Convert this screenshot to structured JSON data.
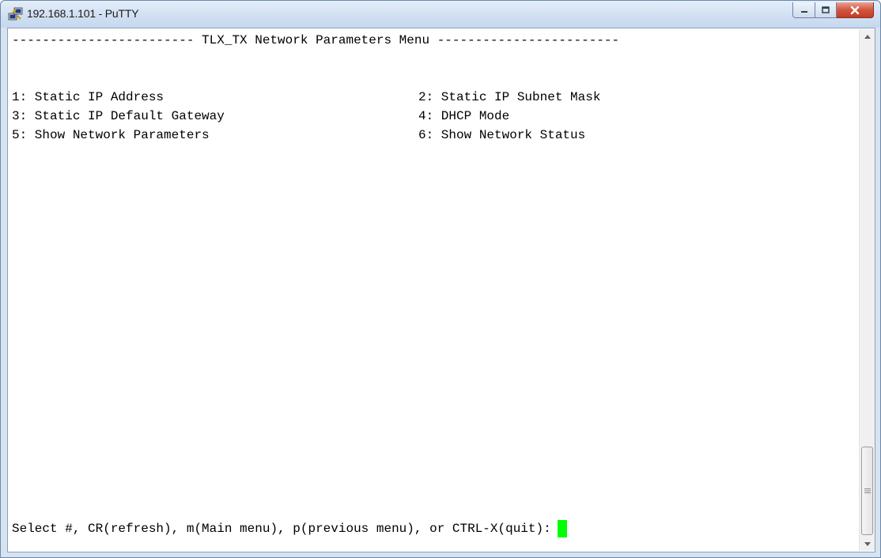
{
  "window": {
    "title": "192.168.1.101 - PuTTY",
    "icon": "putty-icon",
    "controls": [
      "minimize-icon",
      "maximize-icon",
      "close-icon"
    ]
  },
  "terminal": {
    "header": "------------------------ TLX_TX Network Parameters Menu ------------------------",
    "menu_left": [
      "1: Static IP Address",
      "3: Static IP Default Gateway",
      "5: Show Network Parameters"
    ],
    "menu_right": [
      "2: Static IP Subnet Mask",
      "4: DHCP Mode",
      "6: Show Network Status"
    ],
    "prompt": "Select #, CR(refresh), m(Main menu), p(previous menu), or CTRL-X(quit):",
    "cursor_color": "#00ff00"
  },
  "colors": {
    "terminal_bg": "#ffffff",
    "terminal_fg": "#000000",
    "titlebar": "#d2e1f3",
    "close_button": "#c13c25"
  }
}
